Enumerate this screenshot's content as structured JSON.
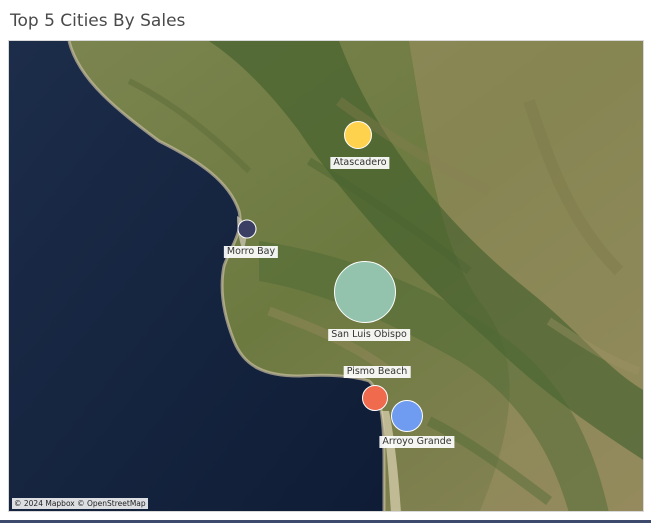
{
  "title": "Top 5 Cities By Sales",
  "attribution": "© 2024 Mapbox © OpenStreetMap",
  "cities": [
    {
      "name": "Atascadero",
      "color": "#ffd24d"
    },
    {
      "name": "Morro Bay",
      "color": "#3b3f63"
    },
    {
      "name": "San Luis Obispo",
      "color": "#93c2ad"
    },
    {
      "name": "Pismo Beach",
      "color": "#f06a4e"
    },
    {
      "name": "Arroyo Grande",
      "color": "#6f9cf0"
    }
  ]
}
